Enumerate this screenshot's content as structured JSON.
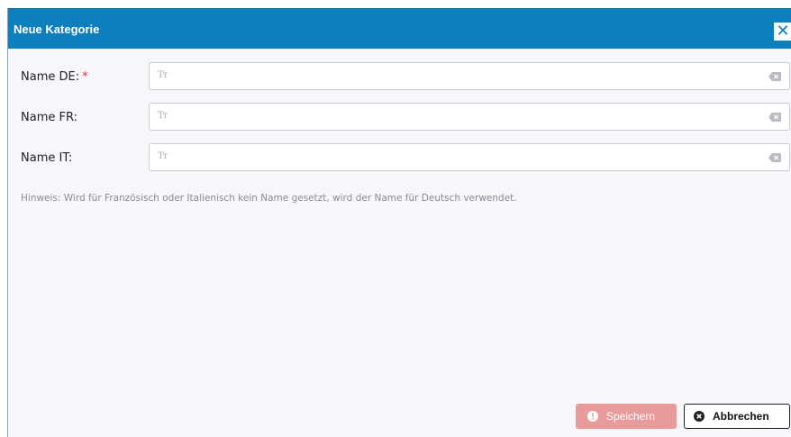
{
  "dialog": {
    "title": "Neue Kategorie",
    "close_icon": "close-icon"
  },
  "form": {
    "fields": [
      {
        "label": "Name DE:",
        "required": true,
        "required_marker": "*",
        "value": "",
        "icon": "text-icon",
        "clear_icon": "clear-icon"
      },
      {
        "label": "Name FR:",
        "required": false,
        "value": "",
        "icon": "text-icon",
        "clear_icon": "clear-icon"
      },
      {
        "label": "Name IT:",
        "required": false,
        "value": "",
        "icon": "text-icon",
        "clear_icon": "clear-icon"
      }
    ],
    "hint": "Hinweis: Wird für Französisch oder Italienisch kein Name gesetzt, wird der Name für Deutsch verwendet."
  },
  "buttons": {
    "save_label": "Speichern",
    "save_icon": "info-circle-icon",
    "cancel_label": "Abbrechen",
    "cancel_icon": "x-circle-icon"
  },
  "colors": {
    "titlebar": "#0e7fbd",
    "save_button_disabled": "#e99a9a",
    "required_marker": "#d33b3b"
  }
}
